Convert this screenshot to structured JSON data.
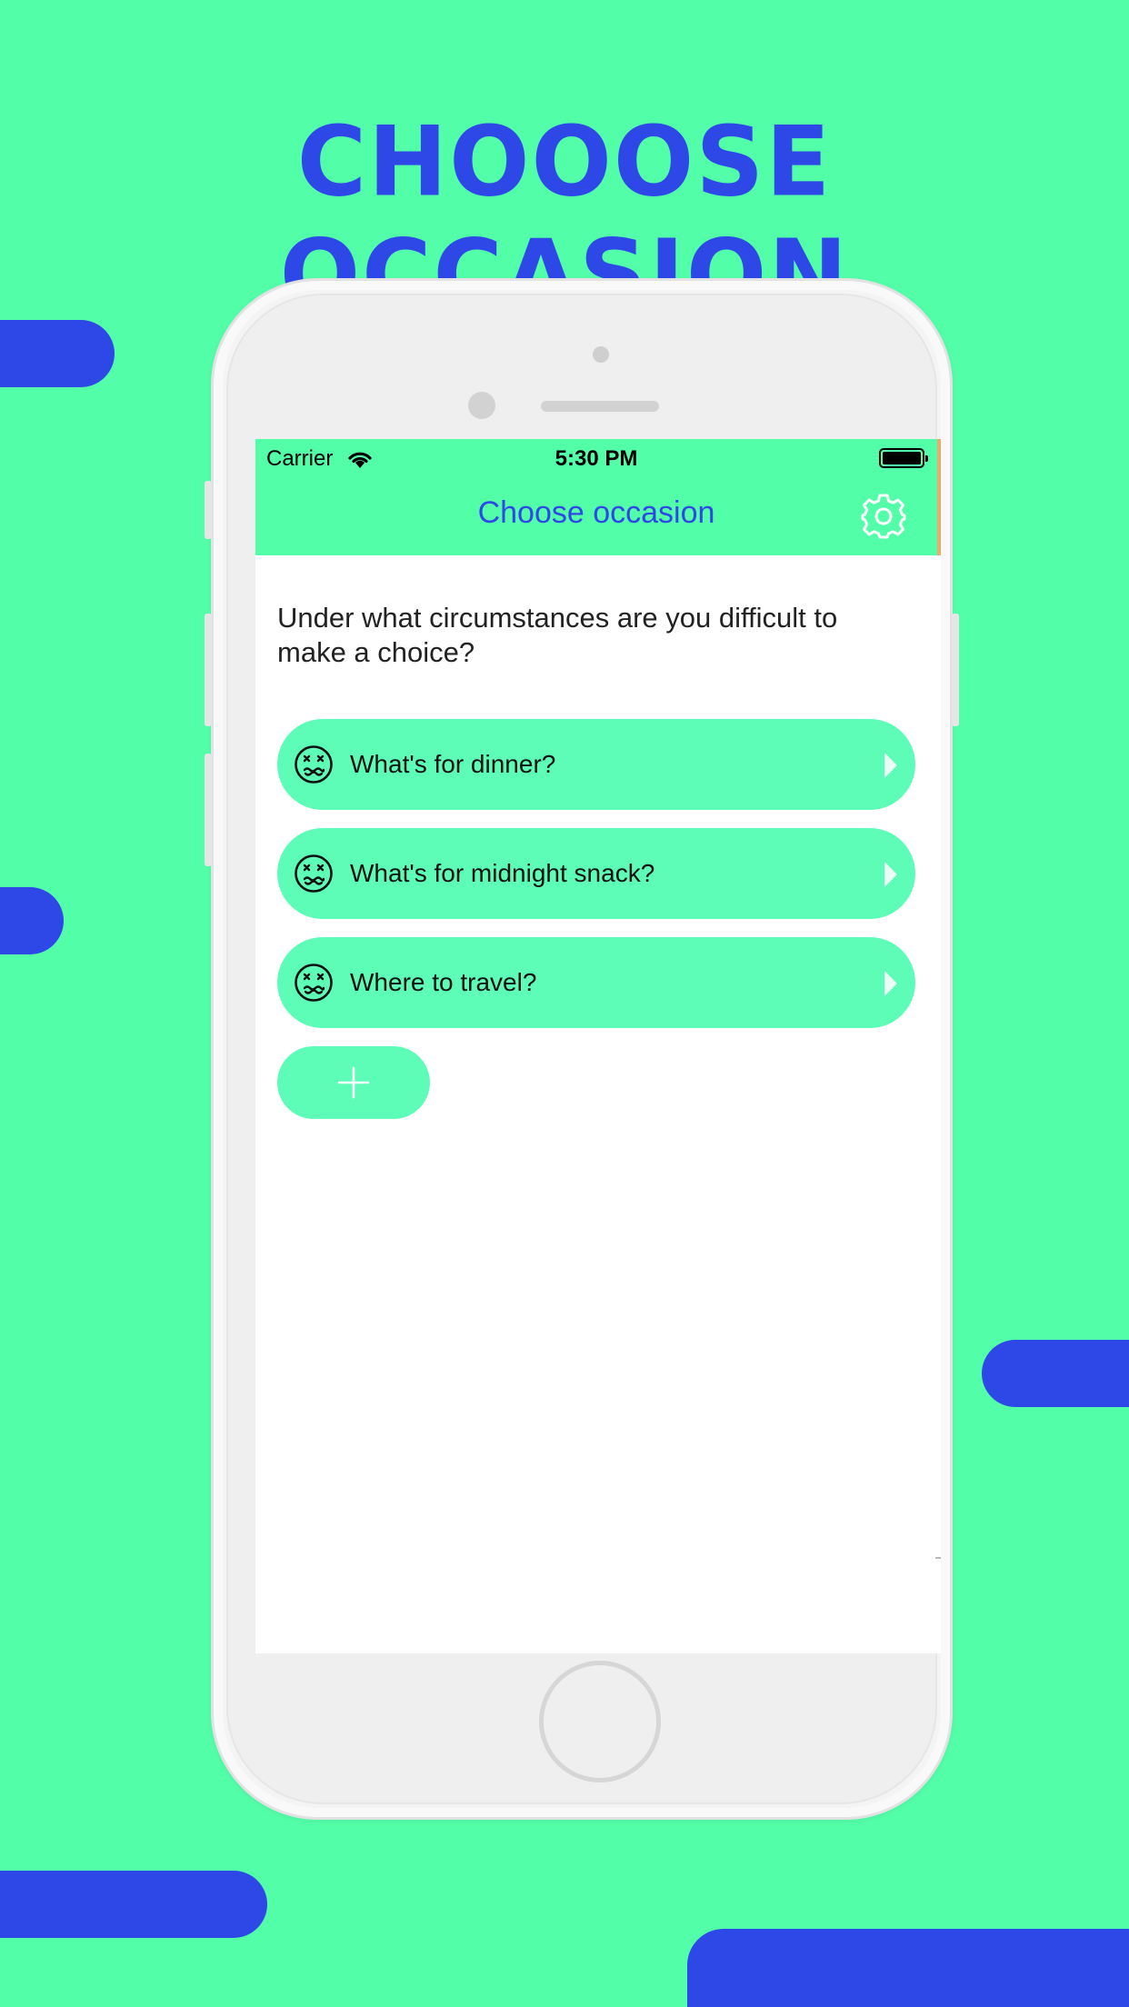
{
  "headline": "CHOOOSE OCCASION",
  "colors": {
    "background": "#53fea9",
    "accent": "#2e48e8",
    "card": "#5dfdb8"
  },
  "status_bar": {
    "carrier": "Carrier",
    "time": "5:30 PM"
  },
  "nav": {
    "title": "Choose occasion",
    "settings_icon": "gear-icon"
  },
  "question": "Under what circumstances are you difficult to make a choice?",
  "occasions": [
    {
      "label": "What's for dinner?",
      "icon": "dizzy-face-icon"
    },
    {
      "label": "What's for midnight snack?",
      "icon": "dizzy-face-icon"
    },
    {
      "label": "Where to travel?",
      "icon": "dizzy-face-icon"
    }
  ],
  "add_button": {
    "icon": "plus-icon"
  }
}
